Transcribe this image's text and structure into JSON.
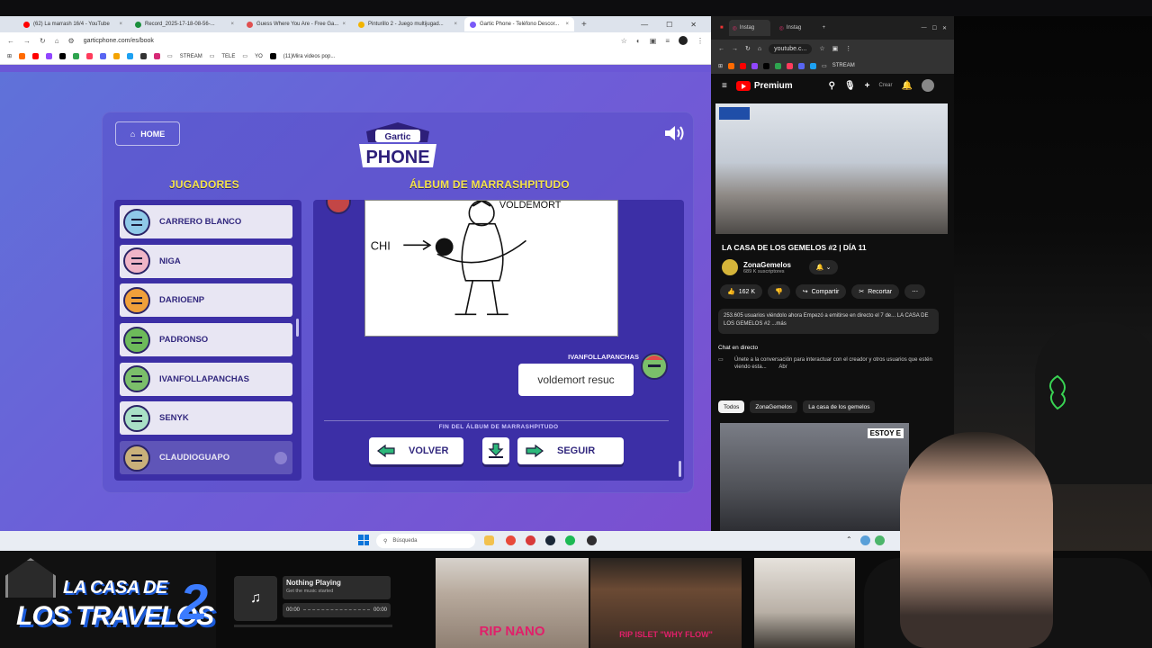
{
  "left_browser": {
    "tabs": [
      {
        "label": "(62) La marrash 16/4 - YouTube",
        "color": "#ff0000"
      },
      {
        "label": "Record_2025-17-18-08-56-...",
        "color": "#1a8f3c"
      },
      {
        "label": "Guess Where You Are - Free Ga...",
        "color": "#e05050"
      },
      {
        "label": "Pinturillo 2 - Juego multijugad...",
        "color": "#f2b400"
      },
      {
        "label": "Gartic Phone - Teléfono Descor...",
        "color": "#7a5af8"
      }
    ],
    "url": "garticphone.com/es/book",
    "bookmarks": [
      "STREAM",
      "TELE",
      "YO",
      "(11)Mira videos pop..."
    ]
  },
  "gartic": {
    "home_label": "HOME",
    "logo_top": "Gartic",
    "logo_bottom": "PHONE",
    "players_heading": "JUGADORES",
    "album_heading": "ÁLBUM DE MARRASHPITUDO",
    "players": [
      {
        "name": "CARRERO BLANCO",
        "avatar_color": "#8fc9e8"
      },
      {
        "name": "NIGA",
        "avatar_color": "#f0b5c7"
      },
      {
        "name": "DARIOENP",
        "avatar_color": "#f0a03a"
      },
      {
        "name": "PADRONSO",
        "avatar_color": "#6dba5a"
      },
      {
        "name": "IVANFOLLAPANCHAS",
        "avatar_color": "#7bbf6a"
      },
      {
        "name": "SENYK",
        "avatar_color": "#a9e0c6"
      },
      {
        "name": "CLAUDIOGUAPO",
        "avatar_color": "#c9b07a"
      }
    ],
    "guess_author": "IVANFOLLAPANCHAS",
    "guess_text": "voldemort resuc",
    "end_label": "FIN DEL ÁLBUM DE MARRASHPITUDO",
    "back_label": "VOLVER",
    "next_label": "SEGUIR",
    "drawing_words": [
      "VOLDEMORT",
      "CHI"
    ],
    "accent_yellow": "#f5e44a"
  },
  "youtube": {
    "tabs": [
      "Instag",
      "Instag"
    ],
    "url": "youtube.c...",
    "bookmark": "STREAM",
    "premium_label": "Premium",
    "create_label": "Crear",
    "video_title": "LA CASA DE LOS GEMELOS #2 | DÍA 11",
    "channel": "ZonaGemelos",
    "subscribers": "689 K suscriptores",
    "likes": "162 K",
    "share": "Compartir",
    "clip": "Recortar",
    "description": "253.605 usuarios viéndolo ahora  Empezó a emitirse en directo el 7 de... LA CASA DE LOS GEMELOS #2 ...más",
    "chat_title": "Chat en directo",
    "chat_text": "Únete a la conversación para interactuar con el creador y otros usuarios que estén viendo esta...",
    "chat_open": "Abr",
    "chips": [
      "Todos",
      "ZonaGemelos",
      "La casa de los gemelos"
    ],
    "thumb_tag": "ESTOY E"
  },
  "taskbar": {
    "search_placeholder": "Búsqueda"
  },
  "stream": {
    "logo_line1": "LA CASA DE",
    "logo_line2": "LOS TRAVELOS",
    "logo_number": "2",
    "now_playing_title": "Nothing Playing",
    "now_playing_sub": "Get the music started",
    "time_start": "00:00",
    "time_end": "00:00",
    "playback_progress": 0,
    "clip1_text": "RIP NANO",
    "clip2_text": "RIP ISLET \"WHY FLOW\""
  }
}
